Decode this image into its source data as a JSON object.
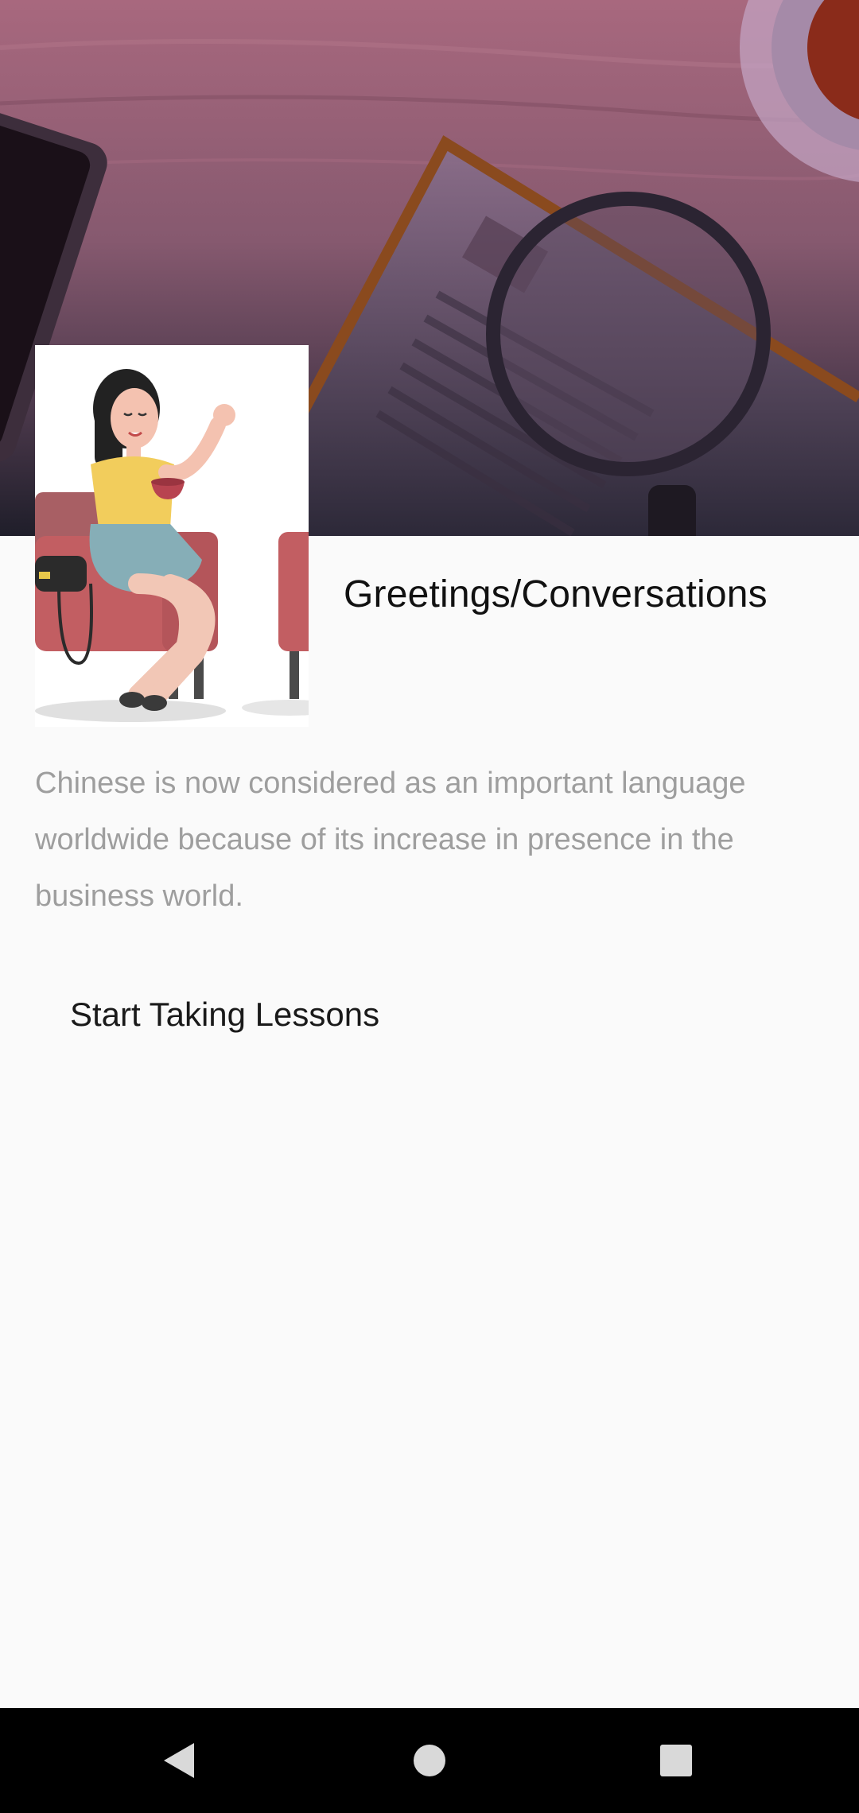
{
  "topic": {
    "title": "Greetings/Conversations",
    "description": "Chinese is now considered as an important language worldwide because of its increase in presence in the business world."
  },
  "actions": {
    "start_label": "Start Taking Lessons"
  },
  "icons": {
    "hero": "desk-banner-image",
    "thumbnail": "woman-on-sofa-illustration",
    "back": "back-triangle-icon",
    "home": "home-circle-icon",
    "recents": "recents-square-icon"
  },
  "colors": {
    "background": "#fafafa",
    "title": "#111111",
    "description": "#9e9e9e",
    "navbar": "#000000",
    "hero_top": "#a8687e",
    "hero_bottom": "#1f1e2a"
  }
}
